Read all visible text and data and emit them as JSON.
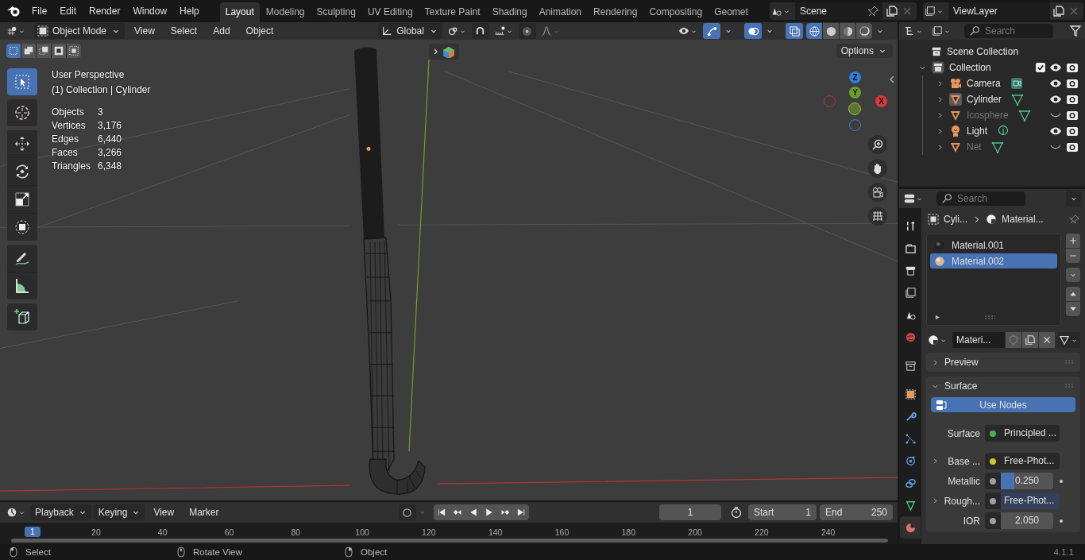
{
  "top_bar": {
    "menus": [
      "File",
      "Edit",
      "Render",
      "Window",
      "Help"
    ],
    "workspaces": [
      {
        "label": "Layout",
        "selected": true
      },
      {
        "label": "Modeling",
        "selected": false
      },
      {
        "label": "Sculpting",
        "selected": false
      },
      {
        "label": "UV Editing",
        "selected": false
      },
      {
        "label": "Texture Paint",
        "selected": false
      },
      {
        "label": "Shading",
        "selected": false
      },
      {
        "label": "Animation",
        "selected": false
      },
      {
        "label": "Rendering",
        "selected": false
      },
      {
        "label": "Compositing",
        "selected": false
      },
      {
        "label": "Geomet",
        "selected": false
      }
    ],
    "scene": "Scene",
    "view_layer": "ViewLayer"
  },
  "viewport": {
    "mode": "Object Mode",
    "menus": [
      "View",
      "Select",
      "Add",
      "Object"
    ],
    "orientation": "Global",
    "options": "Options",
    "snap": {
      "on": false
    },
    "proportional": {
      "on": false
    },
    "toggles": [
      {
        "kind": "gizmo",
        "on": true
      },
      {
        "kind": "overlay",
        "on": true
      },
      {
        "kind": "xray",
        "on": true
      }
    ],
    "shading": [
      {
        "kind": "wireframe",
        "selected": true
      },
      {
        "kind": "solid",
        "selected": false
      },
      {
        "kind": "material",
        "selected": false
      },
      {
        "kind": "rendered",
        "selected": false
      }
    ],
    "select_modes": [
      {
        "kind": "set",
        "selected": true
      },
      {
        "kind": "extend",
        "selected": false
      },
      {
        "kind": "subtract",
        "selected": false
      },
      {
        "kind": "invert",
        "selected": false
      },
      {
        "kind": "intersect",
        "selected": false
      }
    ],
    "view_name": "User Perspective",
    "context": "(1) Collection | Cylinder",
    "stats": [
      {
        "label": "Objects",
        "value": "3"
      },
      {
        "label": "Vertices",
        "value": "3,176"
      },
      {
        "label": "Edges",
        "value": "6,440"
      },
      {
        "label": "Faces",
        "value": "3,266"
      },
      {
        "label": "Triangles",
        "value": "6,348"
      }
    ],
    "tool_groups": [
      [
        {
          "kind": "select_box",
          "selected": true
        }
      ],
      [
        {
          "kind": "cursor",
          "selected": false
        }
      ],
      [
        {
          "kind": "move",
          "selected": false
        },
        {
          "kind": "rotate",
          "selected": false
        },
        {
          "kind": "scale",
          "selected": false
        },
        {
          "kind": "transform",
          "selected": false
        }
      ],
      [
        {
          "kind": "annotate",
          "selected": false
        },
        {
          "kind": "measure",
          "selected": false
        }
      ],
      [
        {
          "kind": "add_cube",
          "selected": false
        }
      ]
    ],
    "gizmo_axes": [
      {
        "label": "Z",
        "color": "#2f7fd9"
      },
      {
        "label": "Y",
        "color": "#6a9e2a"
      },
      {
        "label": "X",
        "color": "#d9363e"
      }
    ]
  },
  "timeline": {
    "menus": [
      "Playback",
      "Keying",
      "View",
      "Marker"
    ],
    "current_frame": "1",
    "start_label": "Start",
    "start": "1",
    "end_label": "End",
    "end": "250",
    "playhead": "1",
    "ruler": [
      "20",
      "40",
      "60",
      "80",
      "100",
      "120",
      "140",
      "160",
      "180",
      "200",
      "220",
      "240"
    ]
  },
  "outliner": {
    "search_placeholder": "Search",
    "root": "Scene Collection",
    "collections": [
      {
        "name": "Collection",
        "expanded": true,
        "checked": true,
        "visible": true,
        "children": [
          {
            "name": "Camera",
            "kind": "camera",
            "visible": true,
            "selected": false
          },
          {
            "name": "Cylinder",
            "kind": "mesh",
            "visible": true,
            "selected": true
          },
          {
            "name": "Icosphere",
            "kind": "mesh",
            "visible": false,
            "selected": false
          },
          {
            "name": "Light",
            "kind": "light",
            "visible": true,
            "selected": false
          },
          {
            "name": "Net",
            "kind": "mesh",
            "visible": false,
            "selected": false
          }
        ]
      }
    ]
  },
  "properties": {
    "search_placeholder": "Search",
    "tabs": [
      {
        "kind": "tool",
        "selected": false
      },
      {
        "kind": "render",
        "selected": false
      },
      {
        "kind": "output",
        "selected": false
      },
      {
        "kind": "view_layer",
        "selected": false
      },
      {
        "kind": "scene",
        "selected": false
      },
      {
        "kind": "world",
        "selected": false
      },
      {
        "kind": "collection",
        "selected": false
      },
      {
        "kind": "object",
        "selected": false
      },
      {
        "kind": "modifiers",
        "selected": false
      },
      {
        "kind": "particles",
        "selected": false
      },
      {
        "kind": "physics",
        "selected": false
      },
      {
        "kind": "constraints",
        "selected": false
      },
      {
        "kind": "data",
        "selected": false
      },
      {
        "kind": "material",
        "selected": true
      }
    ],
    "breadcrumb": [
      "Cyli...",
      "Material..."
    ],
    "material_slots": [
      {
        "name": "Material.001",
        "selected": false
      },
      {
        "name": "Material.002",
        "selected": true
      }
    ],
    "material_name": "Materi...",
    "panels": [
      {
        "title": "Preview",
        "expanded": false
      },
      {
        "title": "Surface",
        "expanded": true
      }
    ],
    "use_nodes": "Use Nodes",
    "fields": [
      {
        "label": "Surface",
        "kind": "link",
        "value": "Principled ...",
        "color": "#4caf50"
      },
      {
        "label": "Base ...",
        "kind": "link",
        "value": "Free-Phot...",
        "color": "#c8c832",
        "expanded": false
      },
      {
        "label": "Metallic",
        "kind": "slider",
        "value": "0.250",
        "level": 0.25,
        "color": "#a0a0a0"
      },
      {
        "label": "Rough...",
        "kind": "link",
        "value": "Free-Phot...",
        "color": "#a0a0a0",
        "expanded": false
      },
      {
        "label": "IOR",
        "kind": "number",
        "value": "2.050",
        "color": "#a0a0a0"
      }
    ]
  },
  "status_bar": {
    "hints": [
      {
        "kind": "left",
        "label": "Select"
      },
      {
        "kind": "middle",
        "label": "Rotate View"
      },
      {
        "kind": "right",
        "label": "Object"
      }
    ],
    "version": "4.1.1"
  }
}
